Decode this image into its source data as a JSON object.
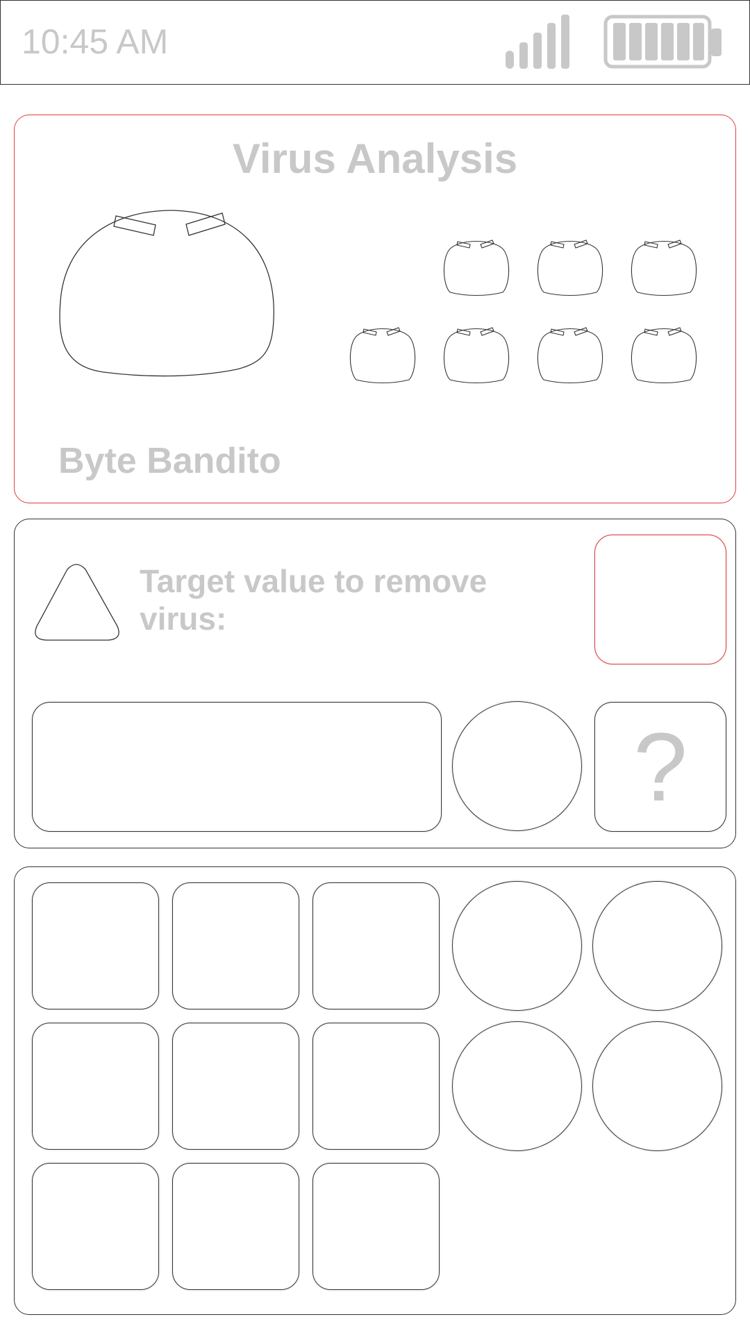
{
  "status_bar": {
    "time": "10:45 AM",
    "signal_icon": "signal-bars-icon",
    "battery_icon": "battery-full-icon"
  },
  "virus_panel": {
    "title": "Virus Analysis",
    "virus_name": "Byte Bandito",
    "main_virus_icon": "virus-blob-icon",
    "remaining_virus_count": 7
  },
  "target_panel": {
    "warning_icon": "warning-triangle-icon",
    "label": "Target value to remove virus:",
    "help_label": "?"
  },
  "keypad": {
    "square_key_count": 9,
    "round_key_count": 4
  },
  "colors": {
    "accent_red": "#e23b3b",
    "outline": "#333333",
    "muted_text": "#c8c8c8"
  }
}
